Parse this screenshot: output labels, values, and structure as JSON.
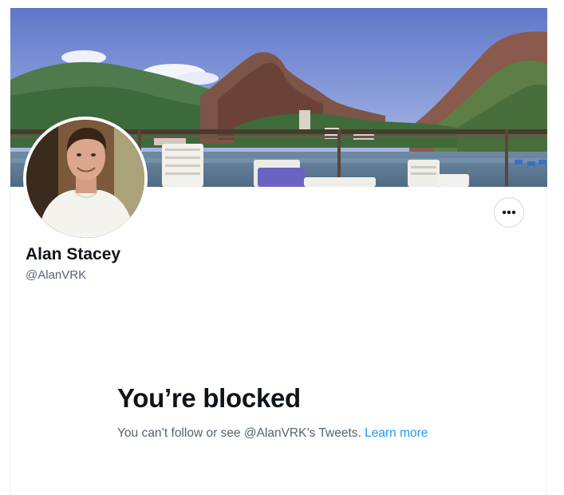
{
  "profile": {
    "display_name": "Alan Stacey",
    "handle": "@AlanVRK",
    "banner_image": "rio-de-janeiro-rooftop-view-with-mountains",
    "avatar_image": "profile-photo-man-white-tshirt"
  },
  "actions": {
    "more_icon": "more-horizontal-icon"
  },
  "blocked": {
    "title": "You’re blocked",
    "message": "You can’t follow or see @AlanVRK’s Tweets. ",
    "learn_more_label": "Learn more"
  },
  "colors": {
    "primary_text": "#0f1419",
    "secondary_text": "#536471",
    "link": "#1d9bf0",
    "border": "#cfd9de"
  }
}
